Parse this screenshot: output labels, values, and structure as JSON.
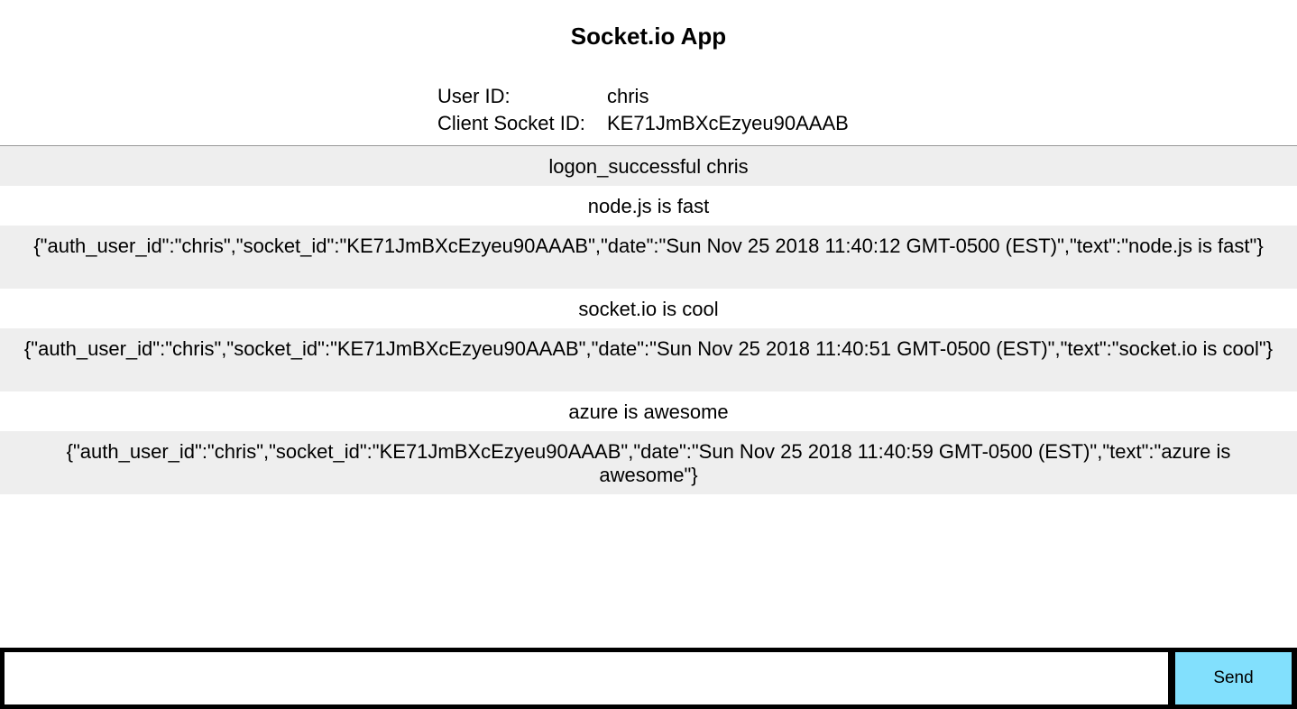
{
  "header": {
    "title": "Socket.io App"
  },
  "user_info": {
    "user_id_label": "User ID:",
    "user_id_value": "chris",
    "socket_id_label": "Client Socket ID:",
    "socket_id_value": "KE71JmBXcEzyeu90AAAB"
  },
  "messages": [
    {
      "text": "logon_successful chris"
    },
    {
      "text": "node.js is fast"
    },
    {
      "text": "{\"auth_user_id\":\"chris\",\"socket_id\":\"KE71JmBXcEzyeu90AAAB\",\"date\":\"Sun Nov 25 2018 11:40:12 GMT-0500 (EST)\",\"text\":\"node.js is fast\"}"
    },
    {
      "text": "socket.io is cool"
    },
    {
      "text": "{\"auth_user_id\":\"chris\",\"socket_id\":\"KE71JmBXcEzyeu90AAAB\",\"date\":\"Sun Nov 25 2018 11:40:51 GMT-0500 (EST)\",\"text\":\"socket.io is cool\"}"
    },
    {
      "text": "azure is awesome"
    },
    {
      "text": "{\"auth_user_id\":\"chris\",\"socket_id\":\"KE71JmBXcEzyeu90AAAB\",\"date\":\"Sun Nov 25 2018 11:40:59 GMT-0500 (EST)\",\"text\":\"azure is awesome\"}"
    }
  ],
  "form": {
    "input_value": "",
    "send_label": "Send"
  },
  "colors": {
    "send_button": "#82e0fd",
    "shaded_row": "#eeeeee",
    "form_bar": "#000000"
  }
}
